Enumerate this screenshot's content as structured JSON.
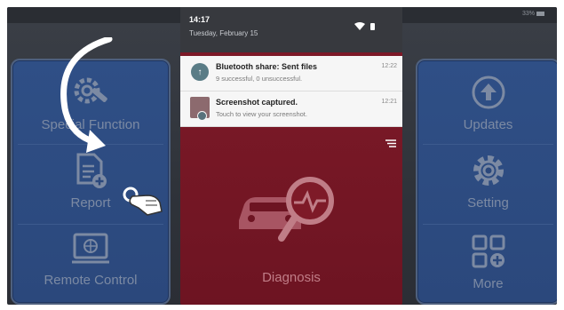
{
  "status": {
    "battery": "33%"
  },
  "notification_shade": {
    "time": "14:17",
    "date": "Tuesday, February 15",
    "notifications": [
      {
        "title": "Bluetooth share: Sent files",
        "subtitle": "9 successful, 0 unsuccessful.",
        "time": "12:22",
        "icon": "upload-icon"
      },
      {
        "title": "Screenshot captured.",
        "subtitle": "Touch to view your screenshot.",
        "time": "12:21",
        "icon": "screenshot-thumbnail"
      }
    ]
  },
  "left_menu": {
    "items": [
      {
        "label": "Special Function",
        "icon": "wrench-gear-icon"
      },
      {
        "label": "Report",
        "icon": "report-add-icon"
      },
      {
        "label": "Remote Control",
        "icon": "remote-monitor-icon"
      }
    ]
  },
  "center": {
    "label": "Diagnosis",
    "icon": "car-diagnosis-icon"
  },
  "right_menu": {
    "items": [
      {
        "label": "Updates",
        "icon": "upload-arrow-icon"
      },
      {
        "label": "Setting",
        "icon": "gear-icon"
      },
      {
        "label": "More",
        "icon": "grid-plus-icon"
      }
    ]
  },
  "colors": {
    "panel_blue": "#2f4f86",
    "diagnosis_red": "#7e1a28",
    "shade_dark": "#37393e"
  }
}
